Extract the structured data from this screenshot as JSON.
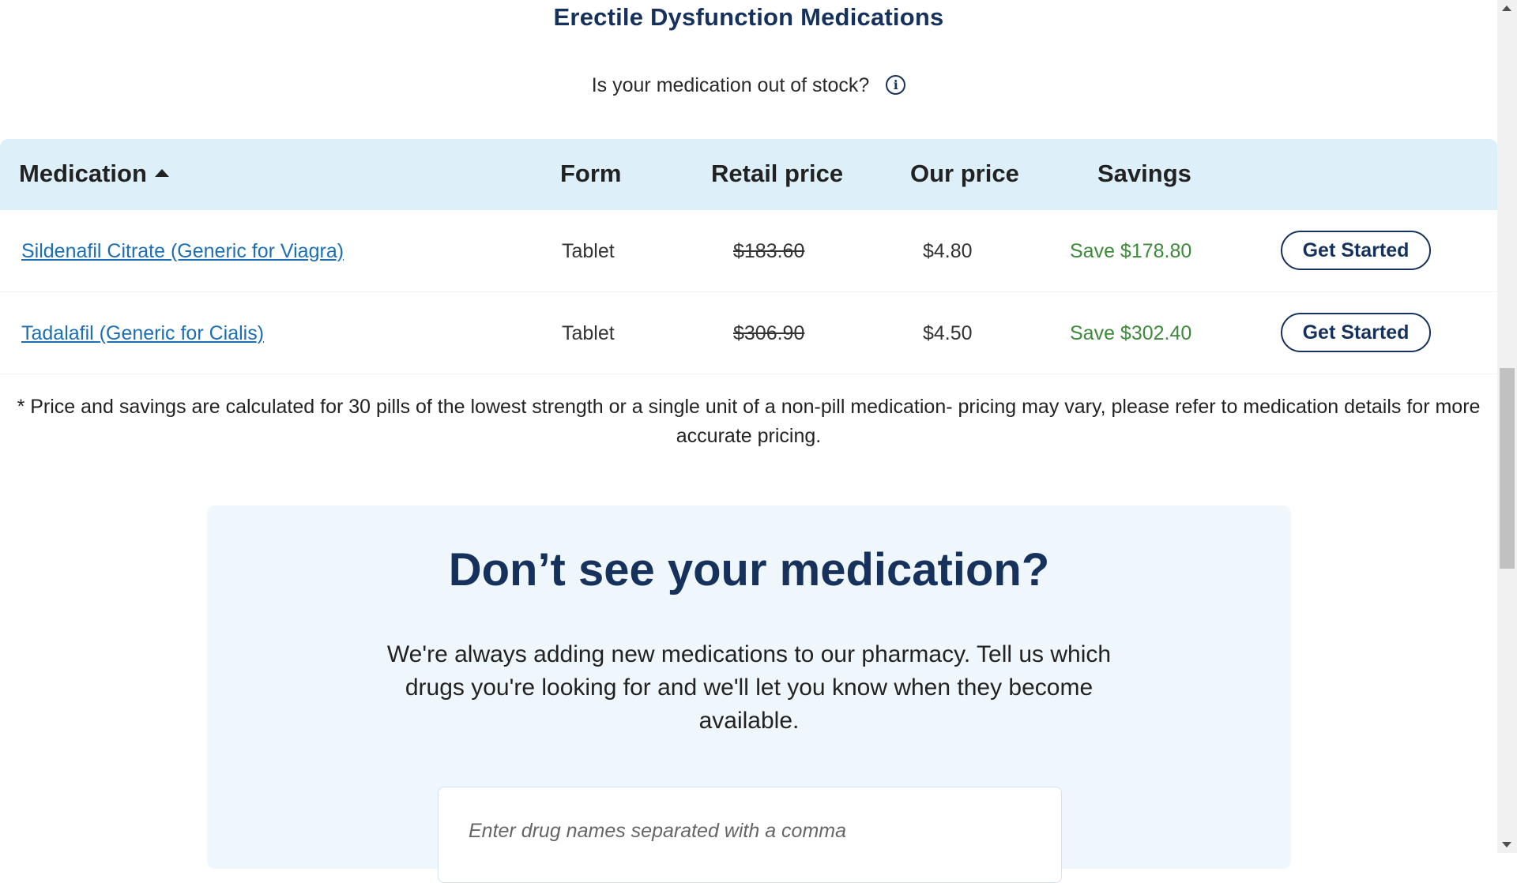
{
  "section": {
    "title": "Erectile Dysfunction Medications",
    "stock_question": "Is your medication out of stock?",
    "info_icon": "i"
  },
  "table": {
    "headers": {
      "medication": "Medication",
      "form": "Form",
      "retail": "Retail price",
      "our": "Our price",
      "savings": "Savings"
    },
    "rows": [
      {
        "name": "Sildenafil Citrate (Generic for Viagra)",
        "form": "Tablet",
        "retail": "$183.60",
        "our": "$4.80",
        "savings": "Save $178.80",
        "button": "Get Started"
      },
      {
        "name": "Tadalafil (Generic for Cialis)",
        "form": "Tablet",
        "retail": "$306.90",
        "our": "$4.50",
        "savings": "Save $302.40",
        "button": "Get Started"
      }
    ]
  },
  "footnote": "* Price and savings are calculated for 30 pills of the lowest strength or a single unit of a non-pill medication- pricing may vary, please refer to medication details for more accurate pricing.",
  "suggest": {
    "title": "Don’t see your medication?",
    "text": "We're always adding new medications to our pharmacy. Tell us which drugs you're looking for and we'll let you know when they become available.",
    "input_placeholder": "Enter drug names separated with a comma"
  },
  "colors": {
    "brand_navy": "#16325c",
    "link_blue": "#1c6fb5",
    "savings_green": "#3d8a3a",
    "header_bg": "#ddf0fa",
    "panel_bg": "#eff7fc"
  }
}
